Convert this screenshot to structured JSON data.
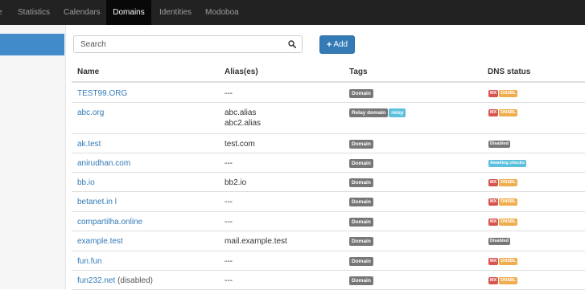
{
  "navbar": {
    "items": [
      {
        "label": "e"
      },
      {
        "label": "Statistics"
      },
      {
        "label": "Calendars"
      },
      {
        "label": "Domains"
      },
      {
        "label": "Identities"
      },
      {
        "label": "Modoboa"
      }
    ],
    "active": "Domains"
  },
  "toolbar": {
    "search_placeholder": "Search",
    "add_label": "Add"
  },
  "table": {
    "headers": [
      "Name",
      "Alias(es)",
      "Tags",
      "DNS status"
    ],
    "rows": [
      {
        "name": "TEST99.ORG",
        "note": "",
        "aliases": [
          "---"
        ],
        "tags": [
          "Domain"
        ],
        "dns": [
          "MX",
          "DNSBL"
        ]
      },
      {
        "name": "abc.org",
        "note": "",
        "aliases": [
          "abc.alias",
          "abc2.alias"
        ],
        "tags": [
          "Relay domain",
          "relay"
        ],
        "dns": [
          "MX",
          "DNSBL"
        ]
      },
      {
        "name": "ak.test",
        "note": "",
        "aliases": [
          "test.com"
        ],
        "tags": [
          "Domain"
        ],
        "dns": [
          "Disabled"
        ]
      },
      {
        "name": "anirudhan.com",
        "note": "",
        "aliases": [
          "---"
        ],
        "tags": [
          "Domain"
        ],
        "dns": [
          "Awaiting checks"
        ]
      },
      {
        "name": "bb.io",
        "note": "",
        "aliases": [
          "bb2.io"
        ],
        "tags": [
          "Domain"
        ],
        "dns": [
          "MX",
          "DNSBL"
        ]
      },
      {
        "name": "betanet.in l",
        "note": "",
        "aliases": [
          "---"
        ],
        "tags": [
          "Domain"
        ],
        "dns": [
          "MX",
          "DNSBL"
        ]
      },
      {
        "name": "compartilha.online",
        "note": "",
        "aliases": [
          "---"
        ],
        "tags": [
          "Domain"
        ],
        "dns": [
          "MX",
          "DNSBL"
        ]
      },
      {
        "name": "example.test",
        "note": "",
        "aliases": [
          "mail.example.test"
        ],
        "tags": [
          "Domain"
        ],
        "dns": [
          "Disabled"
        ]
      },
      {
        "name": "fun.fun",
        "note": "",
        "aliases": [
          "---"
        ],
        "tags": [
          "Domain"
        ],
        "dns": [
          "MX",
          "DNSBL"
        ]
      },
      {
        "name": "fun232.net",
        "note": "(disabled)",
        "aliases": [
          "---"
        ],
        "tags": [
          "Domain"
        ],
        "dns": [
          "MX",
          "DNSBL"
        ]
      }
    ]
  },
  "colors": {
    "navbar_bg": "#222222",
    "navbar_active_bg": "#080808",
    "link": "#337ab7",
    "primary_button": "#337ab7",
    "badge_default": "#777777",
    "badge_info": "#5bc0de",
    "badge_danger": "#d9534f",
    "badge_warning": "#f0ad4e"
  }
}
